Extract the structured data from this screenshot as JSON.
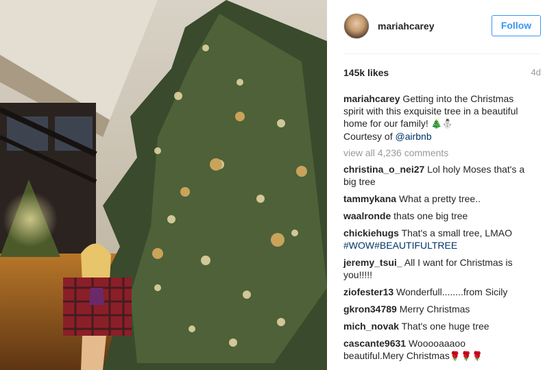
{
  "post": {
    "username": "mariahcarey",
    "follow_label": "Follow",
    "likes": "145k likes",
    "age": "4d",
    "caption": {
      "user": "mariahcarey",
      "text": "Getting into the Christmas spirit with this exquisite tree in a beautiful home for our family!",
      "emoji": "🎄⛄",
      "courtesy_prefix": "Courtesy of ",
      "mention": "@airbnb"
    },
    "view_all": "view all 4,236 comments",
    "comments": [
      {
        "user": "christina_o_nei27",
        "text": "Lol holy Moses that's a big tree"
      },
      {
        "user": "tammykana",
        "text": "What a pretty tree.."
      },
      {
        "user": "waalronde",
        "text": "thats one big tree"
      },
      {
        "user": "chickiehugs",
        "text": "That's a small tree, LMAO",
        "tags": "#WOW#BEAUTIFULTREE"
      },
      {
        "user": "jeremy_tsui_",
        "text": "All I want for Christmas is you!!!!!"
      },
      {
        "user": "ziofester13",
        "text": "Wonderfull........from Sicily"
      },
      {
        "user": "gkron34789",
        "text": "Merry Christmas"
      },
      {
        "user": "mich_novak",
        "text": "That's one huge tree"
      },
      {
        "user": "cascante9631",
        "text": "Wooooaaaoo beautiful.Mery Christmas",
        "emoji": "🌹🌹🌹"
      }
    ]
  },
  "colors": {
    "follow_blue": "#3897f0",
    "link_blue": "#003569",
    "muted_gray": "#999999"
  }
}
